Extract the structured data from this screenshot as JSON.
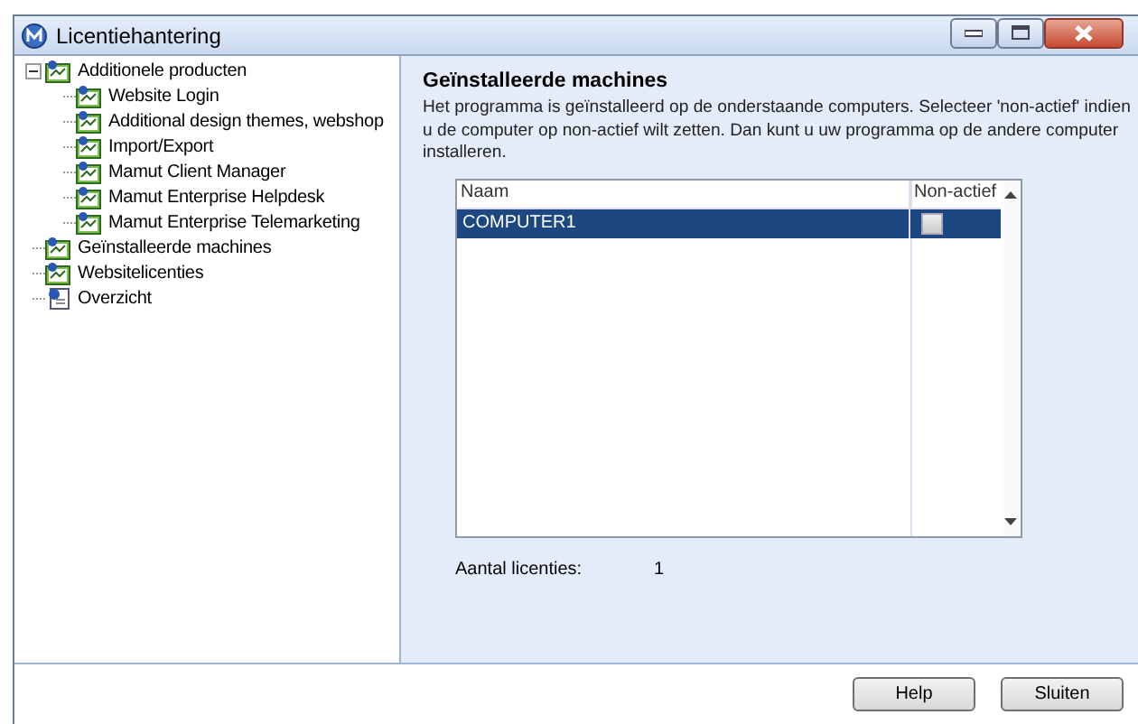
{
  "window": {
    "title": "Licentiehantering"
  },
  "tree": [
    {
      "label": "Additionele producten",
      "expanded": true,
      "kind": "product",
      "children": [
        {
          "label": "Website Login",
          "kind": "product"
        },
        {
          "label": "Additional design themes, webshop",
          "kind": "product"
        },
        {
          "label": "Import/Export",
          "kind": "product"
        },
        {
          "label": "Mamut Client Manager",
          "kind": "product"
        },
        {
          "label": "Mamut Enterprise Helpdesk",
          "kind": "product"
        },
        {
          "label": "Mamut Enterprise Telemarketing",
          "kind": "product"
        }
      ]
    },
    {
      "label": "Geïnstalleerde machines",
      "kind": "product"
    },
    {
      "label": "Websitelicenties",
      "kind": "product"
    },
    {
      "label": "Overzicht",
      "kind": "overview"
    }
  ],
  "panel": {
    "heading": "Geïnstalleerde machines",
    "description": "Het programma is geïnstalleerd op de onderstaande computers. Selecteer 'non-actief' indien u de computer op non-actief wilt zetten. Dan kunt u uw programma op de andere computer installeren."
  },
  "table": {
    "columns": [
      "Naam",
      "Non-actief"
    ],
    "rows": [
      {
        "name": "COMPUTER1",
        "inactive": false,
        "selected": true
      }
    ]
  },
  "license_count": {
    "label": "Aantal licenties:",
    "value": "1"
  },
  "buttons": [
    "Help",
    "Sluiten"
  ]
}
